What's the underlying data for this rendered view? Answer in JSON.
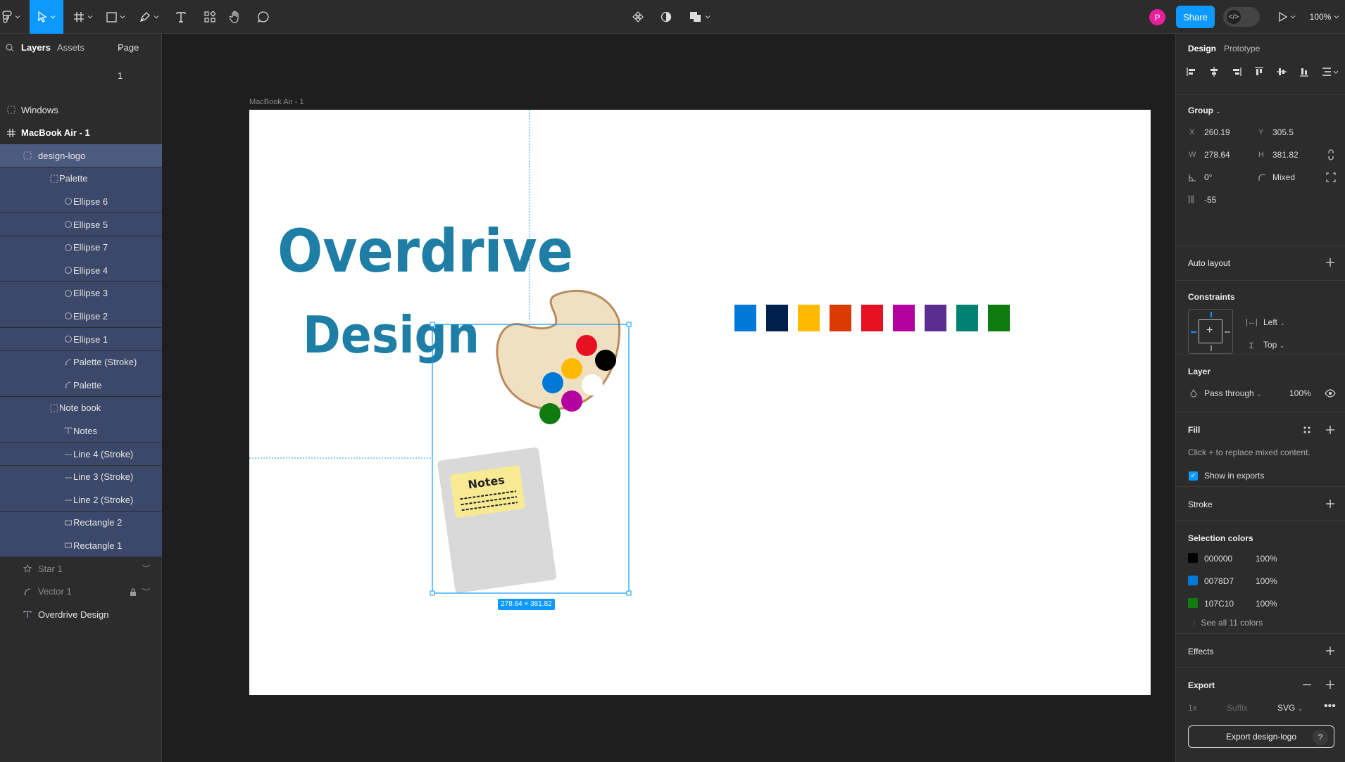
{
  "toolbar": {
    "share_label": "Share",
    "zoom_label": "100%",
    "avatar_initial": "P",
    "avatar_color": "#e91e9b"
  },
  "layers_panel": {
    "tabs": {
      "layers": "Layers",
      "assets": "Assets",
      "page": "Page 1"
    },
    "items": [
      {
        "label": "Windows",
        "icon": "frame-dashed-icon",
        "level": 0,
        "state": "normal"
      },
      {
        "label": "MacBook Air - 1",
        "icon": "frame-hash-icon",
        "level": 0,
        "state": "bold"
      },
      {
        "label": "design-logo",
        "icon": "group-dashed-icon",
        "level": 1,
        "state": "selected"
      },
      {
        "label": "Palette",
        "icon": "group-dashed-icon",
        "level": 2,
        "state": "child"
      },
      {
        "label": "Ellipse 6",
        "icon": "ellipse-icon",
        "level": 3,
        "state": "child"
      },
      {
        "label": "Ellipse 5",
        "icon": "ellipse-icon",
        "level": 3,
        "state": "child"
      },
      {
        "label": "Ellipse 7",
        "icon": "ellipse-icon",
        "level": 3,
        "state": "child"
      },
      {
        "label": "Ellipse 4",
        "icon": "ellipse-icon",
        "level": 3,
        "state": "child"
      },
      {
        "label": "Ellipse 3",
        "icon": "ellipse-icon",
        "level": 3,
        "state": "child"
      },
      {
        "label": "Ellipse 2",
        "icon": "ellipse-icon",
        "level": 3,
        "state": "child"
      },
      {
        "label": "Ellipse 1",
        "icon": "ellipse-icon",
        "level": 3,
        "state": "child"
      },
      {
        "label": "Palette (Stroke)",
        "icon": "vector-icon",
        "level": 3,
        "state": "child"
      },
      {
        "label": "Palette",
        "icon": "vector-icon",
        "level": 3,
        "state": "child"
      },
      {
        "label": "Note book",
        "icon": "group-dashed-icon",
        "level": 2,
        "state": "child"
      },
      {
        "label": "Notes",
        "icon": "text-icon",
        "level": 3,
        "state": "child"
      },
      {
        "label": "Line 4 (Stroke)",
        "icon": "line-icon",
        "level": 3,
        "state": "child"
      },
      {
        "label": "Line 3 (Stroke)",
        "icon": "line-icon",
        "level": 3,
        "state": "child"
      },
      {
        "label": "Line 2 (Stroke)",
        "icon": "line-icon",
        "level": 3,
        "state": "child"
      },
      {
        "label": "Rectangle 2",
        "icon": "rectangle-icon",
        "level": 3,
        "state": "child"
      },
      {
        "label": "Rectangle 1",
        "icon": "rectangle-icon",
        "level": 3,
        "state": "child"
      },
      {
        "label": "Star 1",
        "icon": "star-icon",
        "level": 1,
        "state": "hidden"
      },
      {
        "label": "Vector 1",
        "icon": "vector-icon",
        "level": 1,
        "state": "hidden-locked"
      },
      {
        "label": "Overdrive Design",
        "icon": "text-icon",
        "level": 1,
        "state": "normal"
      }
    ]
  },
  "canvas": {
    "frame_label": "MacBook Air - 1",
    "title_line1": "Overdrive",
    "title_line2": "Design",
    "notes_label": "Notes",
    "selection_size": "278.64 × 381.82",
    "swatches": [
      "#0078d7",
      "#001f4d",
      "#ffb900",
      "#da3b01",
      "#e81123",
      "#b4009e",
      "#5c2d91",
      "#008272",
      "#107c10"
    ],
    "palette_dots": [
      "#e81123",
      "#000000",
      "#ffb900",
      "#0078d7",
      "#ffffff",
      "#b4009e",
      "#107c10"
    ]
  },
  "design_panel": {
    "tabs": {
      "design": "Design",
      "prototype": "Prototype"
    },
    "group": {
      "title": "Group",
      "x_label": "X",
      "x": "260.19",
      "y_label": "Y",
      "y": "305.5",
      "w_label": "W",
      "w": "278.64",
      "h_label": "H",
      "h": "381.82",
      "rotation": "0°",
      "radius": "Mixed",
      "spacing": "-55"
    },
    "auto_layout": "Auto layout",
    "constraints": {
      "title": "Constraints",
      "horizontal": "Left",
      "vertical": "Top"
    },
    "layer": {
      "title": "Layer",
      "blend": "Pass through",
      "opacity": "100%"
    },
    "fill": {
      "title": "Fill",
      "hint": "Click + to replace mixed content.",
      "show_exports": "Show in exports"
    },
    "stroke": "Stroke",
    "selection_colors": {
      "title": "Selection colors",
      "colors": [
        {
          "hex": "000000",
          "opacity": "100%",
          "swatch": "#000000"
        },
        {
          "hex": "0078D7",
          "opacity": "100%",
          "swatch": "#0078d7"
        },
        {
          "hex": "107C10",
          "opacity": "100%",
          "swatch": "#107c10"
        }
      ],
      "see_all": "See all 11 colors"
    },
    "effects": "Effects",
    "export": {
      "title": "Export",
      "scale": "1x",
      "suffix": "Suffix",
      "format": "SVG",
      "button": "Export design-logo",
      "help": "?"
    }
  }
}
